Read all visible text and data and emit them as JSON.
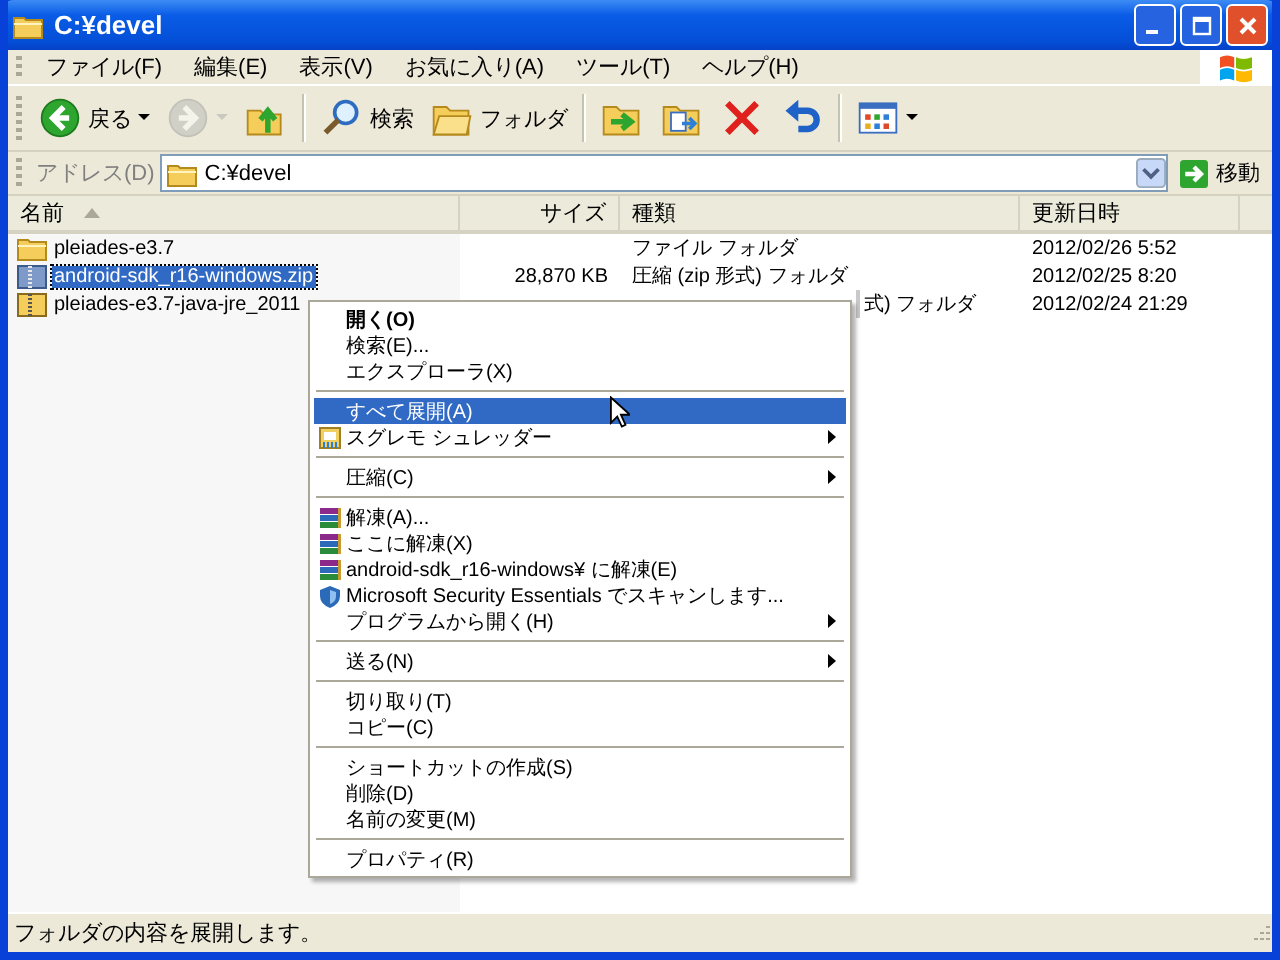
{
  "window": {
    "title": "C:¥devel"
  },
  "menu_bar": [
    "ファイル(F)",
    "編集(E)",
    "表示(V)",
    "お気に入り(A)",
    "ツール(T)",
    "ヘルプ(H)"
  ],
  "toolbar": [
    [
      {
        "kind": "back",
        "label": "戻る",
        "disabled": false
      },
      {
        "kind": "forward",
        "disabled": true
      },
      {
        "kind": "up",
        "disabled": false
      }
    ],
    [
      {
        "kind": "search",
        "label": "検索",
        "disabled": false
      },
      {
        "kind": "folders",
        "label": "フォルダ",
        "disabled": false
      }
    ],
    [
      {
        "kind": "move",
        "disabled": false
      },
      {
        "kind": "copy",
        "disabled": false
      },
      {
        "kind": "delete",
        "disabled": false
      },
      {
        "kind": "undo",
        "disabled": false
      }
    ],
    [
      {
        "kind": "views",
        "disabled": false
      }
    ]
  ],
  "address_bar": {
    "label": "アドレス(D)",
    "value": "C:¥devel",
    "go_label": "移動"
  },
  "columns": [
    {
      "label": "名前",
      "sorted": true
    },
    {
      "label": "サイズ",
      "sorted": false
    },
    {
      "label": "種類",
      "sorted": false
    },
    {
      "label": "更新日時",
      "sorted": false
    }
  ],
  "files": [
    {
      "kind": "folder",
      "name": "pleiades-e3.7",
      "type": "ファイル フォルダ",
      "modified": "2012/02/26 5:52",
      "selected": false,
      "covered": false
    },
    {
      "kind": "zip",
      "name": "android-sdk_r16-windows.zip",
      "size": "28,870 KB",
      "type": "圧縮 (zip 形式) フォルダ",
      "modified": "2012/02/25 8:20",
      "selected": true,
      "covered": false
    },
    {
      "kind": "zip-locked",
      "name": "pleiades-e3.7-java-jre_2011",
      "type": "式) フォルダ",
      "modified": "2012/02/24 21:29",
      "selected": false,
      "covered": true
    }
  ],
  "context_menu": [
    [
      {
        "kind": "plain",
        "label": "開く(O)",
        "default": true,
        "selected": false,
        "submenu": false
      },
      {
        "kind": "plain",
        "label": "検索(E)...",
        "default": false,
        "selected": false,
        "submenu": false
      },
      {
        "kind": "plain",
        "label": "エクスプローラ(X)",
        "default": false,
        "selected": false,
        "submenu": false
      }
    ],
    [
      {
        "kind": "plain",
        "label": "すべて展開(A)",
        "default": false,
        "selected": true,
        "submenu": false
      },
      {
        "kind": "shredder",
        "label": "スグレモ シュレッダー",
        "default": false,
        "selected": false,
        "submenu": true
      }
    ],
    [
      {
        "kind": "plain",
        "label": "圧縮(C)",
        "default": false,
        "selected": false,
        "submenu": true
      }
    ],
    [
      {
        "kind": "archive",
        "label": "解凍(A)...",
        "default": false,
        "selected": false,
        "submenu": false
      },
      {
        "kind": "archive",
        "label": "ここに解凍(X)",
        "default": false,
        "selected": false,
        "submenu": false
      },
      {
        "kind": "archive",
        "label": "android-sdk_r16-windows¥ に解凍(E)",
        "default": false,
        "selected": false,
        "submenu": false
      },
      {
        "kind": "shield",
        "label": "Microsoft Security Essentials でスキャンします...",
        "default": false,
        "selected": false,
        "submenu": false
      },
      {
        "kind": "plain",
        "label": "プログラムから開く(H)",
        "default": false,
        "selected": false,
        "submenu": true
      }
    ],
    [
      {
        "kind": "plain",
        "label": "送る(N)",
        "default": false,
        "selected": false,
        "submenu": true
      }
    ],
    [
      {
        "kind": "plain",
        "label": "切り取り(T)",
        "default": false,
        "selected": false,
        "submenu": false
      },
      {
        "kind": "plain",
        "label": "コピー(C)",
        "default": false,
        "selected": false,
        "submenu": false
      }
    ],
    [
      {
        "kind": "plain",
        "label": "ショートカットの作成(S)",
        "default": false,
        "selected": false,
        "submenu": false
      },
      {
        "kind": "plain",
        "label": "削除(D)",
        "default": false,
        "selected": false,
        "submenu": false
      },
      {
        "kind": "plain",
        "label": "名前の変更(M)",
        "default": false,
        "selected": false,
        "submenu": false
      }
    ],
    [
      {
        "kind": "plain",
        "label": "プロパティ(R)",
        "default": false,
        "selected": false,
        "submenu": false
      }
    ]
  ],
  "status_bar": "フォルダの内容を展開します。"
}
